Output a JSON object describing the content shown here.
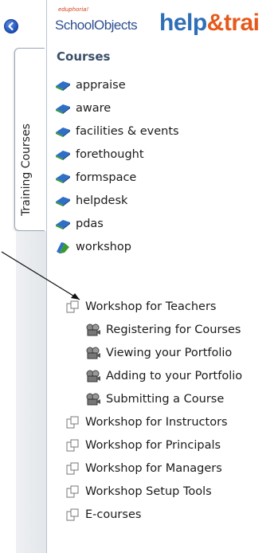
{
  "logo": {
    "eduphoria": "eduphoria!",
    "school_objects": "SchoolObjects",
    "help_part1": "help",
    "help_part2": "&trai"
  },
  "vertical_tab": {
    "label": "Training Courses"
  },
  "courses_heading": "Courses",
  "courses": [
    {
      "label": "appraise",
      "icon": "book-icon"
    },
    {
      "label": "aware",
      "icon": "book-icon"
    },
    {
      "label": "facilities & events",
      "icon": "book-icon"
    },
    {
      "label": "forethought",
      "icon": "book-icon"
    },
    {
      "label": "formspace",
      "icon": "book-icon"
    },
    {
      "label": "helpdesk",
      "icon": "book-icon"
    },
    {
      "label": "pdas",
      "icon": "book-icon"
    },
    {
      "label": "workshop",
      "icon": "open-book-icon"
    }
  ],
  "workshop_children": {
    "expanded_course": {
      "label": "Workshop for Teachers",
      "icon": "page-icon"
    },
    "lessons": [
      {
        "label": "Registering for Courses",
        "icon": "film-reel-icon"
      },
      {
        "label": "Viewing your Portfolio",
        "icon": "film-reel-icon"
      },
      {
        "label": "Adding to your Portfolio",
        "icon": "film-reel-icon"
      },
      {
        "label": "Submitting a Course",
        "icon": "film-reel-icon"
      }
    ],
    "other_courses": [
      {
        "label": "Workshop for Instructors",
        "icon": "page-icon"
      },
      {
        "label": "Workshop for Principals",
        "icon": "page-icon"
      },
      {
        "label": "Workshop for Managers",
        "icon": "page-icon"
      },
      {
        "label": "Workshop Setup Tools",
        "icon": "page-icon"
      },
      {
        "label": "E-courses",
        "icon": "page-icon"
      }
    ]
  },
  "colors": {
    "book_blue": "#2f6fc6",
    "book_green": "#3a9a2e",
    "heading": "#3a4f6a",
    "logo_blue": "#2f6fb8",
    "logo_orange": "#e55a1c"
  }
}
